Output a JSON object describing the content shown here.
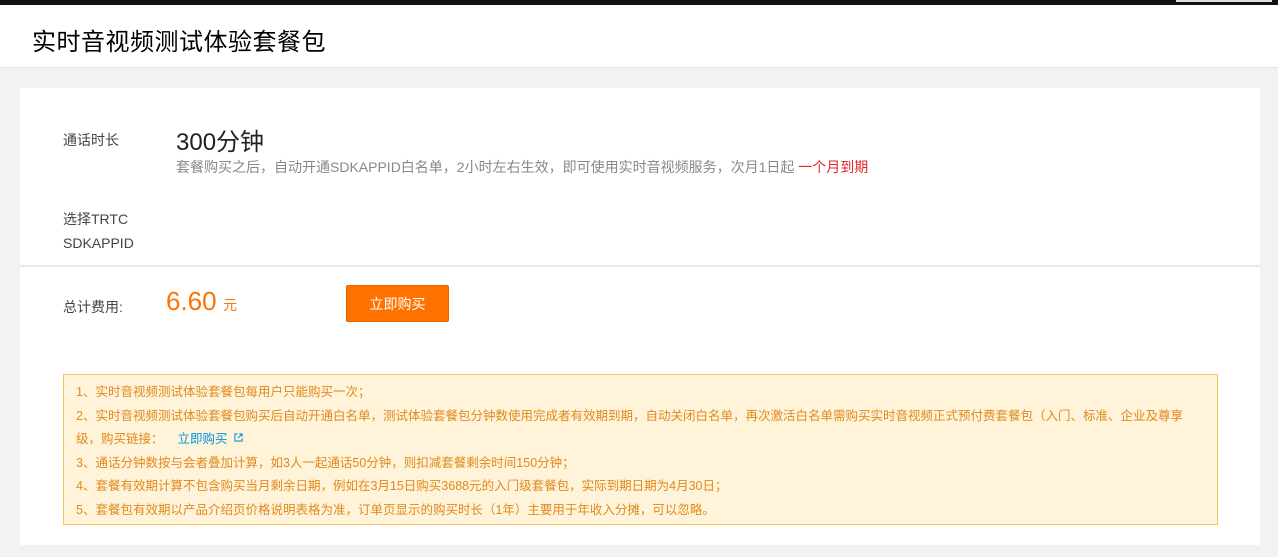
{
  "page": {
    "title": "实时音视频测试体验套餐包"
  },
  "package": {
    "duration_label": "通话时长",
    "duration_value": "300分钟",
    "description": "套餐购买之后，自动开通SDKAPPID白名单，2小时左右生效，即可使用实时音视频服务，次月1日起",
    "description_highlight": "一个月到期",
    "sdk_label_line1": "选择TRTC",
    "sdk_label_line2": "SDKAPPID"
  },
  "total": {
    "label": "总计费用:",
    "price": "6.60",
    "currency": "元",
    "buy_button": "立即购买"
  },
  "notice": {
    "item1": "1、实时音视频测试体验套餐包每用户只能购买一次；",
    "item2": "2、实时音视频测试体验套餐包购买后自动开通白名单，测试体验套餐包分钟数使用完成者有效期到期，自动关闭白名单，再次激活白名单需购买实时音视频正式预付费套餐包（入门、标准、企业及尊享级，购买链接：",
    "item2_link": "立即购买",
    "item3": "3、通话分钟数按与会者叠加计算，如3人一起通话50分钟，则扣减套餐剩余时间150分钟；",
    "item4": "4、套餐有效期计算不包含购买当月剩余日期，例如在3月15日购买3688元的入门级套餐包，实际到期日期为4月30日；",
    "item5": "5、套餐包有效期以产品介绍页价格说明表格为准，订单页显示的购买时长（1年）主要用于年收入分摊，可以忽略。"
  },
  "colors": {
    "accent": "#ff7200",
    "highlight_red": "#e1242c",
    "notice_bg": "#fff4d9",
    "notice_border": "#f5c560",
    "notice_text": "#e0891f",
    "link": "#0095e0"
  },
  "icons": {
    "external_link": "external-link-icon"
  }
}
